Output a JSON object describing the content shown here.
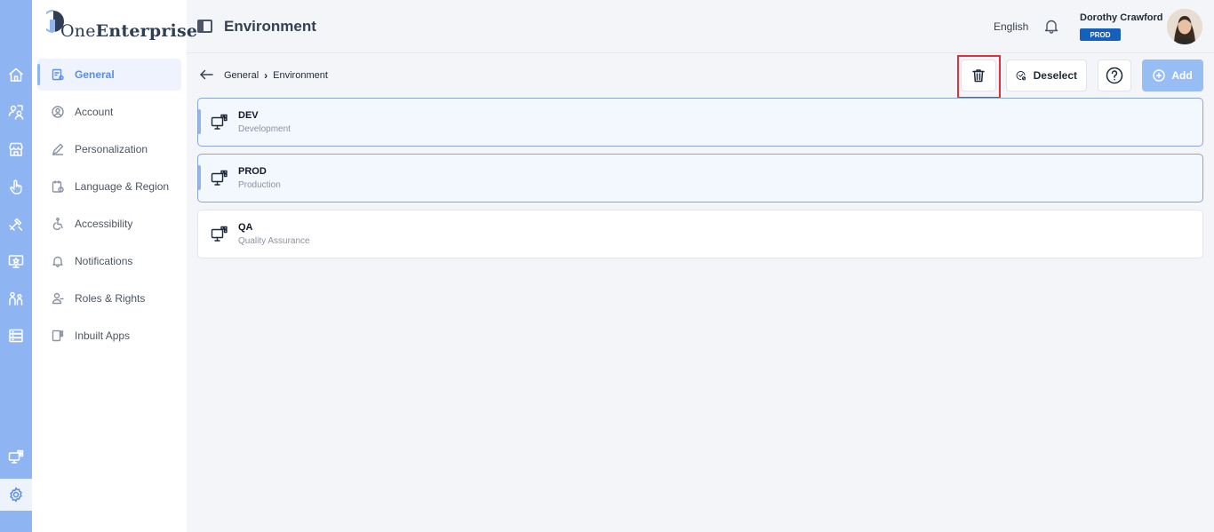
{
  "app": {
    "brand_prefix": "One",
    "brand_suffix": "Enterprise"
  },
  "rail": {
    "items": [
      "home-icon",
      "users-swap-icon",
      "store-icon",
      "touch-icon",
      "tools-icon",
      "monitor-star-icon",
      "team-icon",
      "server-icon"
    ],
    "bottom_items": [
      "environment-monitor-icon",
      "settings-gear-icon"
    ]
  },
  "sidebar": {
    "items": [
      {
        "label": "General",
        "icon": "general-settings-icon",
        "active": true
      },
      {
        "label": "Account",
        "icon": "account-icon"
      },
      {
        "label": "Personalization",
        "icon": "pencil-icon"
      },
      {
        "label": "Language & Region",
        "icon": "language-icon"
      },
      {
        "label": "Accessibility",
        "icon": "accessibility-icon"
      },
      {
        "label": "Notifications",
        "icon": "bell-icon"
      },
      {
        "label": "Roles & Rights",
        "icon": "roles-icon"
      },
      {
        "label": "Inbuilt Apps",
        "icon": "apps-icon"
      }
    ]
  },
  "header": {
    "title": "Environment",
    "language": "English",
    "user_name": "Dorothy Crawford",
    "env_badge": "PROD"
  },
  "breadcrumb": {
    "parent": "General",
    "separator": "›",
    "current": "Environment"
  },
  "toolbar": {
    "deselect_label": "Deselect",
    "add_label": "Add"
  },
  "environments": [
    {
      "code": "DEV",
      "name": "Development",
      "selected": true
    },
    {
      "code": "PROD",
      "name": "Production",
      "selected": true
    },
    {
      "code": "QA",
      "name": "Quality Assurance",
      "selected": false
    }
  ],
  "colors": {
    "rail": "#8fb4f2",
    "accent": "#5b8ee6",
    "badge": "#1560bd",
    "add_button": "#97bdf5",
    "highlight": "#e0303b"
  }
}
